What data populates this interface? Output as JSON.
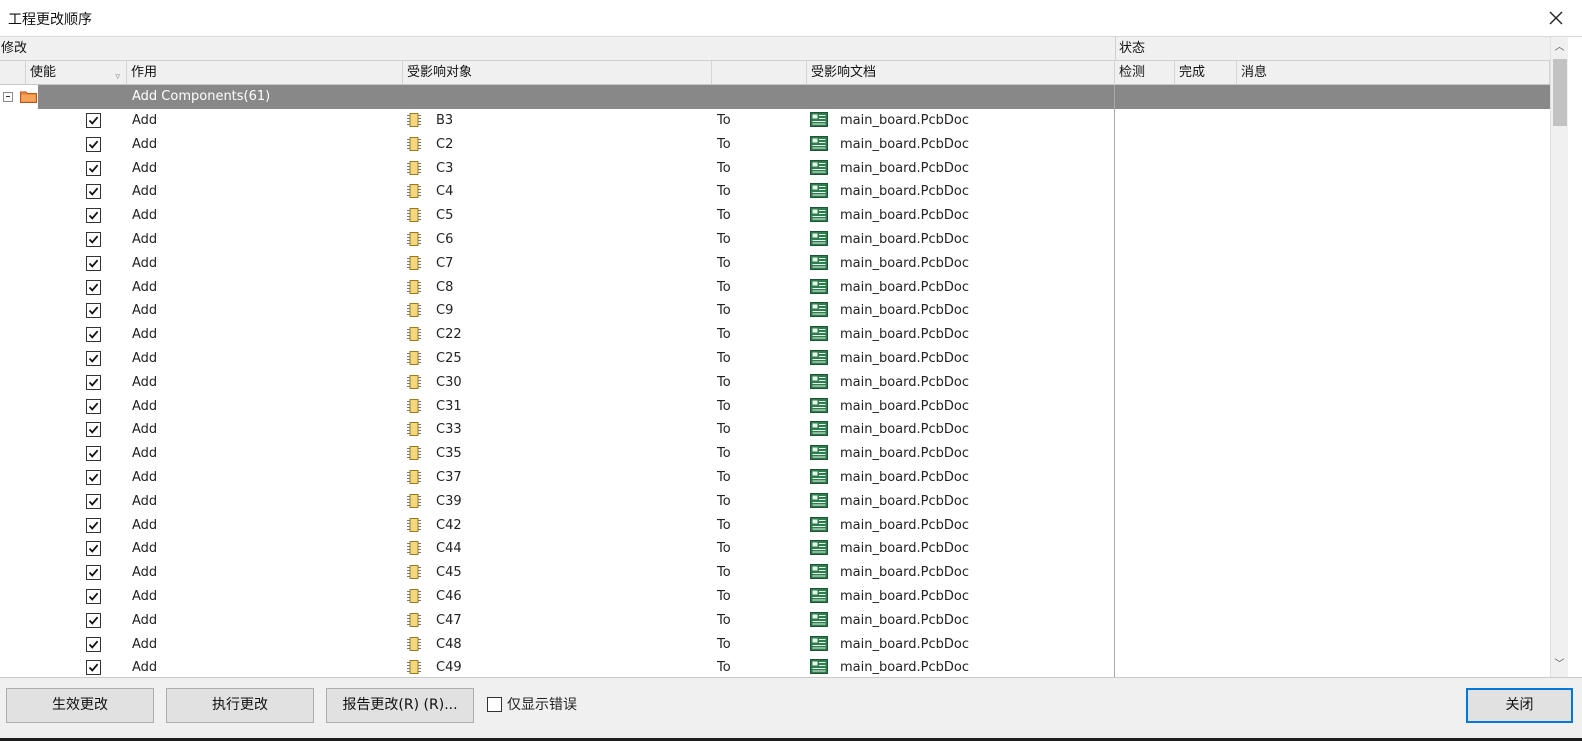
{
  "window": {
    "title": "工程更改顺序"
  },
  "grid": {
    "group_headers": {
      "modify": "修改",
      "status": "状态"
    },
    "columns": {
      "enable": "使能",
      "action": "作用",
      "affected_object": "受影响对象",
      "affected_doc": "受影响文档",
      "check": "检测",
      "done": "完成",
      "message": "消息"
    },
    "group": {
      "label": "Add Components(61)"
    },
    "rows": [
      {
        "enabled": true,
        "action": "Add",
        "object": "B3",
        "to": "To",
        "doc": "main_board.PcbDoc"
      },
      {
        "enabled": true,
        "action": "Add",
        "object": "C2",
        "to": "To",
        "doc": "main_board.PcbDoc"
      },
      {
        "enabled": true,
        "action": "Add",
        "object": "C3",
        "to": "To",
        "doc": "main_board.PcbDoc"
      },
      {
        "enabled": true,
        "action": "Add",
        "object": "C4",
        "to": "To",
        "doc": "main_board.PcbDoc"
      },
      {
        "enabled": true,
        "action": "Add",
        "object": "C5",
        "to": "To",
        "doc": "main_board.PcbDoc"
      },
      {
        "enabled": true,
        "action": "Add",
        "object": "C6",
        "to": "To",
        "doc": "main_board.PcbDoc"
      },
      {
        "enabled": true,
        "action": "Add",
        "object": "C7",
        "to": "To",
        "doc": "main_board.PcbDoc"
      },
      {
        "enabled": true,
        "action": "Add",
        "object": "C8",
        "to": "To",
        "doc": "main_board.PcbDoc"
      },
      {
        "enabled": true,
        "action": "Add",
        "object": "C9",
        "to": "To",
        "doc": "main_board.PcbDoc"
      },
      {
        "enabled": true,
        "action": "Add",
        "object": "C22",
        "to": "To",
        "doc": "main_board.PcbDoc"
      },
      {
        "enabled": true,
        "action": "Add",
        "object": "C25",
        "to": "To",
        "doc": "main_board.PcbDoc"
      },
      {
        "enabled": true,
        "action": "Add",
        "object": "C30",
        "to": "To",
        "doc": "main_board.PcbDoc"
      },
      {
        "enabled": true,
        "action": "Add",
        "object": "C31",
        "to": "To",
        "doc": "main_board.PcbDoc"
      },
      {
        "enabled": true,
        "action": "Add",
        "object": "C33",
        "to": "To",
        "doc": "main_board.PcbDoc"
      },
      {
        "enabled": true,
        "action": "Add",
        "object": "C35",
        "to": "To",
        "doc": "main_board.PcbDoc"
      },
      {
        "enabled": true,
        "action": "Add",
        "object": "C37",
        "to": "To",
        "doc": "main_board.PcbDoc"
      },
      {
        "enabled": true,
        "action": "Add",
        "object": "C39",
        "to": "To",
        "doc": "main_board.PcbDoc"
      },
      {
        "enabled": true,
        "action": "Add",
        "object": "C42",
        "to": "To",
        "doc": "main_board.PcbDoc"
      },
      {
        "enabled": true,
        "action": "Add",
        "object": "C44",
        "to": "To",
        "doc": "main_board.PcbDoc"
      },
      {
        "enabled": true,
        "action": "Add",
        "object": "C45",
        "to": "To",
        "doc": "main_board.PcbDoc"
      },
      {
        "enabled": true,
        "action": "Add",
        "object": "C46",
        "to": "To",
        "doc": "main_board.PcbDoc"
      },
      {
        "enabled": true,
        "action": "Add",
        "object": "C47",
        "to": "To",
        "doc": "main_board.PcbDoc"
      },
      {
        "enabled": true,
        "action": "Add",
        "object": "C48",
        "to": "To",
        "doc": "main_board.PcbDoc"
      },
      {
        "enabled": true,
        "action": "Add",
        "object": "C49",
        "to": "To",
        "doc": "main_board.PcbDoc"
      }
    ]
  },
  "footer": {
    "validate_label": "生效更改",
    "execute_label": "执行更改",
    "report_label": "报告更改(R) (R)...",
    "errors_only_label": "仅显示错误",
    "errors_only_checked": false,
    "close_label": "关闭"
  },
  "icons": {
    "folder": "folder-icon",
    "component": "component-icon",
    "pcb_doc": "pcb-document-icon",
    "close": "close-icon"
  },
  "colors": {
    "group_bar": "#888888",
    "header_bg": "#f0f0f0",
    "default_button_border": "#0078d7",
    "pcb_icon": "#2e7d4f",
    "component_icon": "#c9a23f"
  }
}
